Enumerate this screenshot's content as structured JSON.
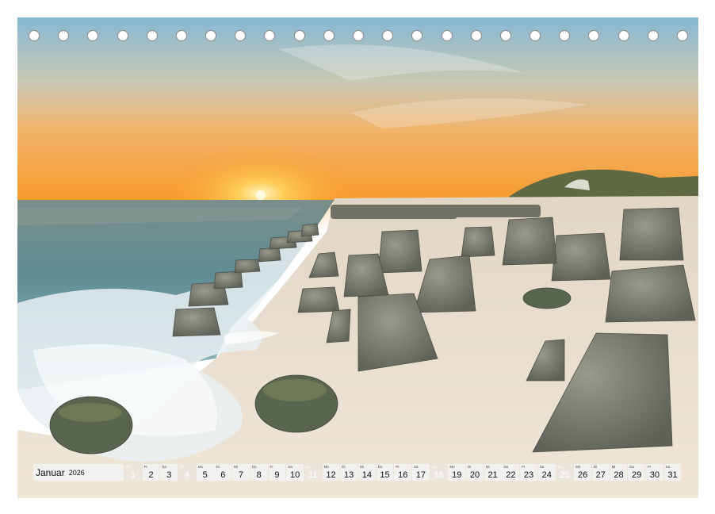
{
  "calendar": {
    "month": "Januar",
    "year": "2026",
    "days": [
      {
        "n": "1",
        "wd": "Do",
        "sun": true
      },
      {
        "n": "2",
        "wd": "Fr",
        "sun": false
      },
      {
        "n": "3",
        "wd": "Sa",
        "sun": false
      },
      {
        "n": "4",
        "wd": "So",
        "sun": true
      },
      {
        "n": "5",
        "wd": "Mo",
        "sun": false
      },
      {
        "n": "6",
        "wd": "Di",
        "sun": false
      },
      {
        "n": "7",
        "wd": "Mi",
        "sun": false
      },
      {
        "n": "8",
        "wd": "Do",
        "sun": false
      },
      {
        "n": "9",
        "wd": "Fr",
        "sun": false
      },
      {
        "n": "10",
        "wd": "Sa",
        "sun": false
      },
      {
        "n": "11",
        "wd": "So",
        "sun": true
      },
      {
        "n": "12",
        "wd": "Mo",
        "sun": false
      },
      {
        "n": "13",
        "wd": "Di",
        "sun": false
      },
      {
        "n": "14",
        "wd": "Mi",
        "sun": false
      },
      {
        "n": "15",
        "wd": "Do",
        "sun": false
      },
      {
        "n": "16",
        "wd": "Fr",
        "sun": false
      },
      {
        "n": "17",
        "wd": "Sa",
        "sun": false
      },
      {
        "n": "18",
        "wd": "So",
        "sun": true
      },
      {
        "n": "19",
        "wd": "Mo",
        "sun": false
      },
      {
        "n": "20",
        "wd": "Di",
        "sun": false
      },
      {
        "n": "21",
        "wd": "Mi",
        "sun": false
      },
      {
        "n": "22",
        "wd": "Do",
        "sun": false
      },
      {
        "n": "23",
        "wd": "Fr",
        "sun": false
      },
      {
        "n": "24",
        "wd": "Sa",
        "sun": false
      },
      {
        "n": "25",
        "wd": "So",
        "sun": true
      },
      {
        "n": "26",
        "wd": "Mo",
        "sun": false
      },
      {
        "n": "27",
        "wd": "Di",
        "sun": false
      },
      {
        "n": "28",
        "wd": "Mi",
        "sun": false
      },
      {
        "n": "29",
        "wd": "Do",
        "sun": false
      },
      {
        "n": "30",
        "wd": "Fr",
        "sun": false
      },
      {
        "n": "31",
        "wd": "Sa",
        "sun": false
      }
    ]
  },
  "colors": {
    "sky_top": "#7fb6d6",
    "sky_horizon": "#f7a83a",
    "sun": "#fff3b0",
    "sea": "#5d8c93",
    "sand": "#e9dccb",
    "tetrapod": "#7d7d73"
  },
  "binding_holes": 23
}
